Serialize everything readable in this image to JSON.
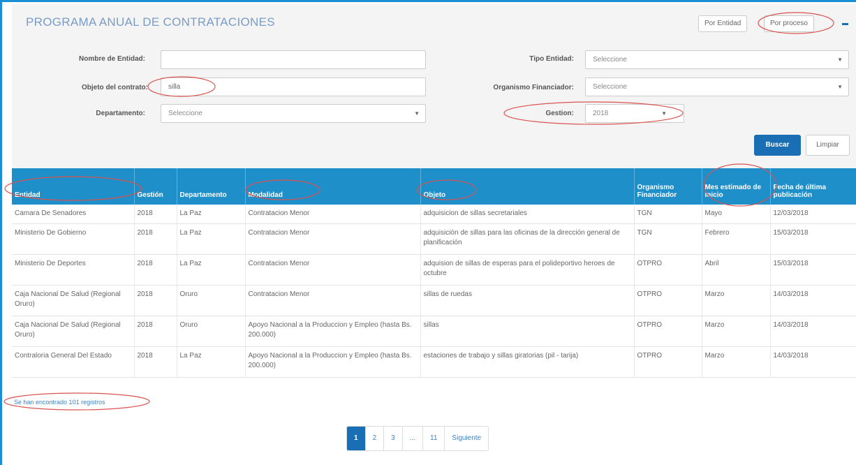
{
  "header": {
    "title": "PROGRAMA ANUAL DE CONTRATACIONES",
    "toggle_entity": "Por Entidad",
    "toggle_process": "Por proceso"
  },
  "filters": {
    "entity_name_label": "Nombre de Entidad:",
    "entity_name_value": "",
    "contract_object_label": "Objeto del contrato:",
    "contract_object_value": "silla",
    "department_label": "Departamento:",
    "department_value": "Seleccione",
    "entity_type_label": "Tipo Entidad:",
    "entity_type_value": "Seleccione",
    "financing_label": "Organismo Financiador:",
    "financing_value": "Seleccione",
    "gestion_label": "Gestion:",
    "gestion_value": "2018",
    "search_label": "Buscar",
    "clear_label": "Limpiar"
  },
  "table": {
    "columns": [
      "Entidad",
      "Gestión",
      "Departamento",
      "Modalidad",
      "Objeto",
      "Organismo Financiador",
      "Mes estimado de inicio",
      "Fecha de última publicación"
    ],
    "rows": [
      [
        "Camara De Senadores",
        "2018",
        "La Paz",
        "Contratacion Menor",
        "adquisicion de sillas secretariales",
        "TGN",
        "Mayo",
        "12/03/2018"
      ],
      [
        "Ministerio De Gobierno",
        "2018",
        "La Paz",
        "Contratacion Menor",
        "adquisición de sillas para las oficinas de la dirección general de planificación",
        "TGN",
        "Febrero",
        "15/03/2018"
      ],
      [
        "Ministerio De Deportes",
        "2018",
        "La Paz",
        "Contratacion Menor",
        "adquision de sillas de esperas para el polideportivo heroes de octubre",
        "OTPRO",
        "Abril",
        "15/03/2018"
      ],
      [
        "Caja Nacional De Salud (Regional Oruro)",
        "2018",
        "Oruro",
        "Contratacion Menor",
        "sillas de ruedas",
        "OTPRO",
        "Marzo",
        "14/03/2018"
      ],
      [
        "Caja Nacional De Salud (Regional Oruro)",
        "2018",
        "Oruro",
        "Apoyo Nacional a la Produccion y Empleo (hasta Bs. 200.000)",
        "sillas",
        "OTPRO",
        "Marzo",
        "14/03/2018"
      ],
      [
        "Contraloria General Del Estado",
        "2018",
        "La Paz",
        "Apoyo Nacional a la Produccion y Empleo (hasta Bs. 200.000)",
        "estaciones de trabajo y sillas giratorias (pil - tarija)",
        "OTPRO",
        "Marzo",
        "14/03/2018"
      ]
    ]
  },
  "results": {
    "found_text": "Se han encontrado 101 registros"
  },
  "pagination": {
    "pages": [
      "1",
      "2",
      "3",
      "...",
      "11",
      "Siguiente"
    ]
  },
  "colors": {
    "accent": "#1f8fc9",
    "button": "#1a6fb4",
    "annotation": "#d9534f"
  }
}
